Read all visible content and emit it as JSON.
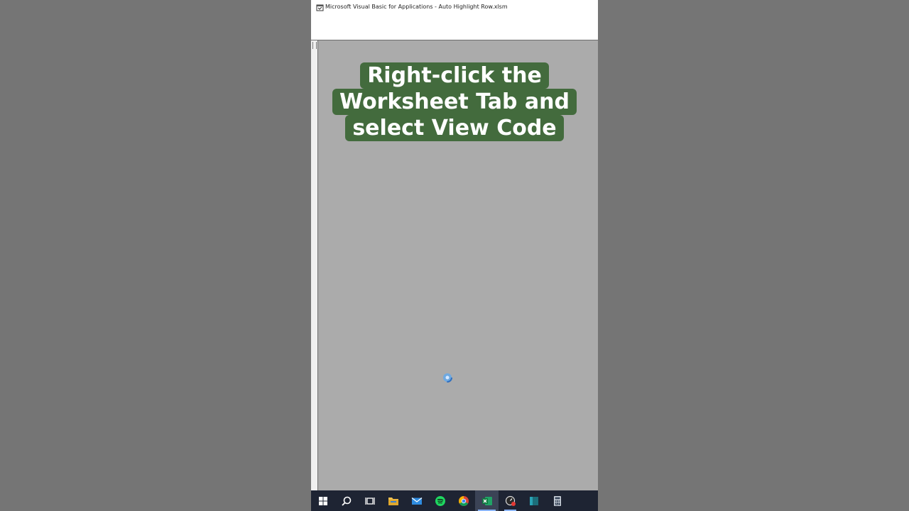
{
  "window": {
    "title": "Microsoft Visual Basic for Applications - Auto Highlight Row.xlsm"
  },
  "caption": {
    "lines": [
      "Right-click the",
      "Worksheet Tab and",
      "select View Code"
    ]
  },
  "colors": {
    "background": "#757575",
    "client_area": "#ababab",
    "caption_bg": "#436b3d",
    "caption_text": "#ffffff",
    "taskbar": "#1e2433"
  },
  "taskbar": {
    "items": [
      {
        "icon": "windows-start-icon"
      },
      {
        "icon": "search-icon"
      },
      {
        "icon": "task-view-icon"
      },
      {
        "icon": "file-explorer-icon"
      },
      {
        "icon": "mail-icon"
      },
      {
        "icon": "spotify-icon"
      },
      {
        "icon": "chrome-icon"
      },
      {
        "icon": "excel-icon",
        "state": "active"
      },
      {
        "icon": "screen-recorder-icon",
        "state": "open"
      },
      {
        "icon": "app-icon"
      },
      {
        "icon": "calculator-icon"
      }
    ]
  }
}
